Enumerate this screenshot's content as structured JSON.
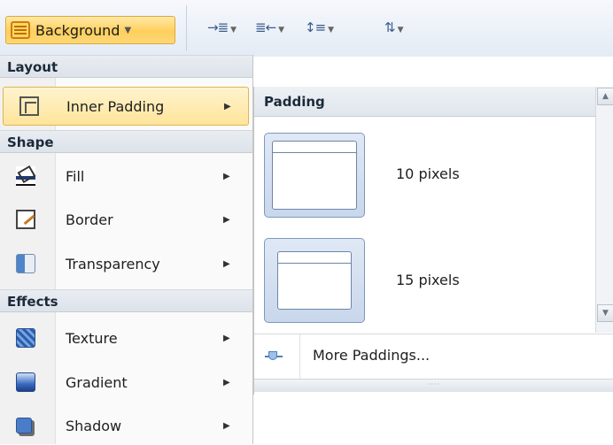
{
  "ribbon": {
    "background_button": {
      "label": "Background",
      "icon": "background-icon"
    },
    "tools": [
      {
        "icon": "indent-increase-icon",
        "glyph": "→≣"
      },
      {
        "icon": "indent-decrease-icon",
        "glyph": "≣←"
      },
      {
        "icon": "line-spacing-icon",
        "glyph": "↕≡"
      },
      {
        "icon": "text-direction-icon",
        "glyph": "⇅"
      }
    ]
  },
  "menu": {
    "sections": [
      {
        "title": "Layout"
      },
      {
        "title": "Shape"
      },
      {
        "title": "Effects"
      }
    ],
    "items": [
      {
        "label": "Inner Padding",
        "icon": "inner-padding-icon"
      },
      {
        "label": "Fill",
        "icon": "paint-bucket-icon"
      },
      {
        "label": "Border",
        "icon": "border-pencil-icon"
      },
      {
        "label": "Transparency",
        "icon": "transparency-icon"
      },
      {
        "label": "Texture",
        "icon": "texture-icon"
      },
      {
        "label": "Gradient",
        "icon": "gradient-icon"
      },
      {
        "label": "Shadow",
        "icon": "shadow-icon"
      }
    ]
  },
  "submenu": {
    "title": "Padding",
    "options": [
      {
        "label": "10 pixels"
      },
      {
        "label": "15 pixels"
      }
    ],
    "more_label": "More Paddings...",
    "grip": "····"
  },
  "colors": {
    "accent_highlight": "#ffe49a",
    "accent_border": "#e0b451",
    "tile_fill": "#c9d7ec"
  }
}
